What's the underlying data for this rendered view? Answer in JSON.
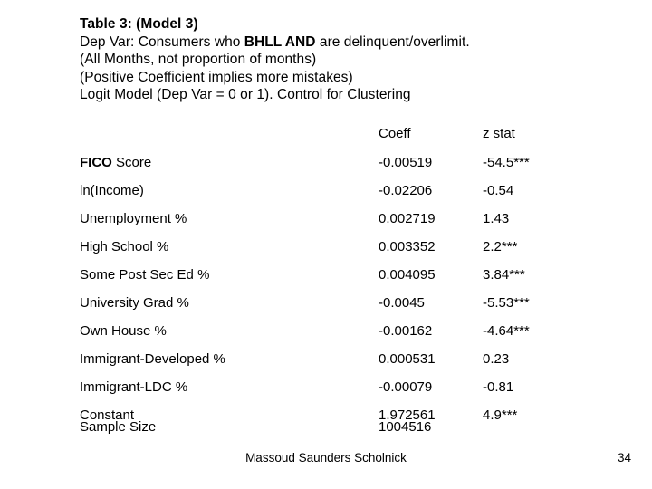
{
  "slide": {
    "title_lines": [
      {
        "text": "Table 3: (Model 3)",
        "bold": true
      },
      {
        "text": "Dep Var: Consumers who BHLL AND are delinquent/overlimit.",
        "bold": false
      },
      {
        "text": "(All Months, not proportion of months)",
        "bold": false
      },
      {
        "text": "(Positive Coefficient implies more mistakes)",
        "bold": false
      },
      {
        "text": "Logit Model (Dep Var = 0 or 1). Control for Clustering",
        "bold": false
      }
    ],
    "title_line_1": "Table 3: (Model 3)",
    "title_line_2_pre": "Dep Var: Consumers who ",
    "title_line_2_bold": "BHLL AND",
    "title_line_2_post": " are delinquent/overlimit.",
    "title_line_3": "(All Months, not proportion of months)",
    "title_line_4": "(Positive Coefficient implies more mistakes)",
    "title_line_5": "Logit Model (Dep Var = 0 or 1). Control for Clustering"
  },
  "table": {
    "columns": [
      "",
      "Coeff",
      "z stat"
    ],
    "header_coeff": "Coeff",
    "header_zstat": "z stat",
    "rows": [
      {
        "label_bold": "FICO",
        "label_rest": " Score",
        "label": "FICO Score",
        "coeff": "-0.00519",
        "zstat": "-54.5***"
      },
      {
        "label_bold": "",
        "label_rest": "",
        "label": "ln(Income)",
        "coeff": "-0.02206",
        "zstat": "-0.54"
      },
      {
        "label_bold": "",
        "label_rest": "",
        "label": "Unemployment %",
        "coeff": "0.002719",
        "zstat": "1.43"
      },
      {
        "label_bold": "",
        "label_rest": "",
        "label": "High School %",
        "coeff": "0.003352",
        "zstat": "2.2***"
      },
      {
        "label_bold": "",
        "label_rest": "",
        "label": "Some Post Sec Ed %",
        "coeff": "0.004095",
        "zstat": "3.84***"
      },
      {
        "label_bold": "",
        "label_rest": "",
        "label": "University Grad %",
        "coeff": "-0.0045",
        "zstat": "-5.53***"
      },
      {
        "label_bold": "",
        "label_rest": "",
        "label": "Own House %",
        "coeff": "-0.00162",
        "zstat": "-4.64***"
      },
      {
        "label_bold": "",
        "label_rest": "",
        "label": "Immigrant-Developed %",
        "coeff": "0.000531",
        "zstat": "0.23"
      },
      {
        "label_bold": "",
        "label_rest": "",
        "label": "Immigrant-LDC %",
        "coeff": "-0.00079",
        "zstat": "-0.81"
      },
      {
        "label_bold": "",
        "label_rest": "",
        "label": "Constant",
        "coeff": "1.972561",
        "zstat": "4.9***"
      }
    ],
    "sample_size_label": "Sample Size",
    "sample_size_value": "1004516"
  },
  "footer": {
    "authors": "Massoud Saunders Scholnick",
    "page_number": "34"
  }
}
